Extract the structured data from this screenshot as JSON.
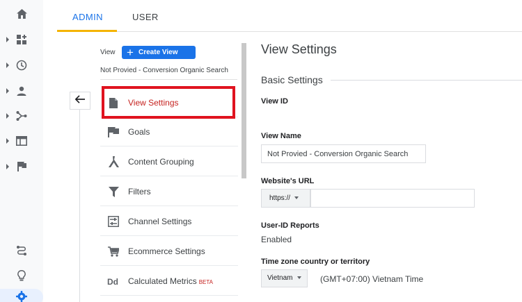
{
  "tabs": {
    "admin": "ADMIN",
    "user": "USER"
  },
  "middle": {
    "view_label": "View",
    "create_view": "Create View",
    "view_name": "Not Provied - Conversion Organic Search",
    "menu": [
      {
        "label": "View Settings",
        "icon": "document-icon"
      },
      {
        "label": "Goals",
        "icon": "flag-icon"
      },
      {
        "label": "Content Grouping",
        "icon": "content-grouping-icon"
      },
      {
        "label": "Filters",
        "icon": "filter-icon"
      },
      {
        "label": "Channel Settings",
        "icon": "channel-settings-icon"
      },
      {
        "label": "Ecommerce Settings",
        "icon": "cart-icon"
      },
      {
        "label": "Calculated Metrics",
        "icon": "dd-icon",
        "badge": "BETA"
      }
    ]
  },
  "panel": {
    "title": "View Settings",
    "section": "Basic Settings",
    "view_id_label": "View ID",
    "view_name_label": "View Name",
    "view_name_value": "Not Provied - Conversion Organic Search",
    "url_label": "Website's URL",
    "url_protocol": "https://",
    "userid_label": "User-ID Reports",
    "userid_value": "Enabled",
    "tz_label": "Time zone country or territory",
    "tz_country": "Vietnam",
    "tz_value": "(GMT+07:00) Vietnam Time"
  },
  "colors": {
    "accent": "#1a73e8",
    "highlight": "#e0131f",
    "active_text": "#c5221f"
  }
}
